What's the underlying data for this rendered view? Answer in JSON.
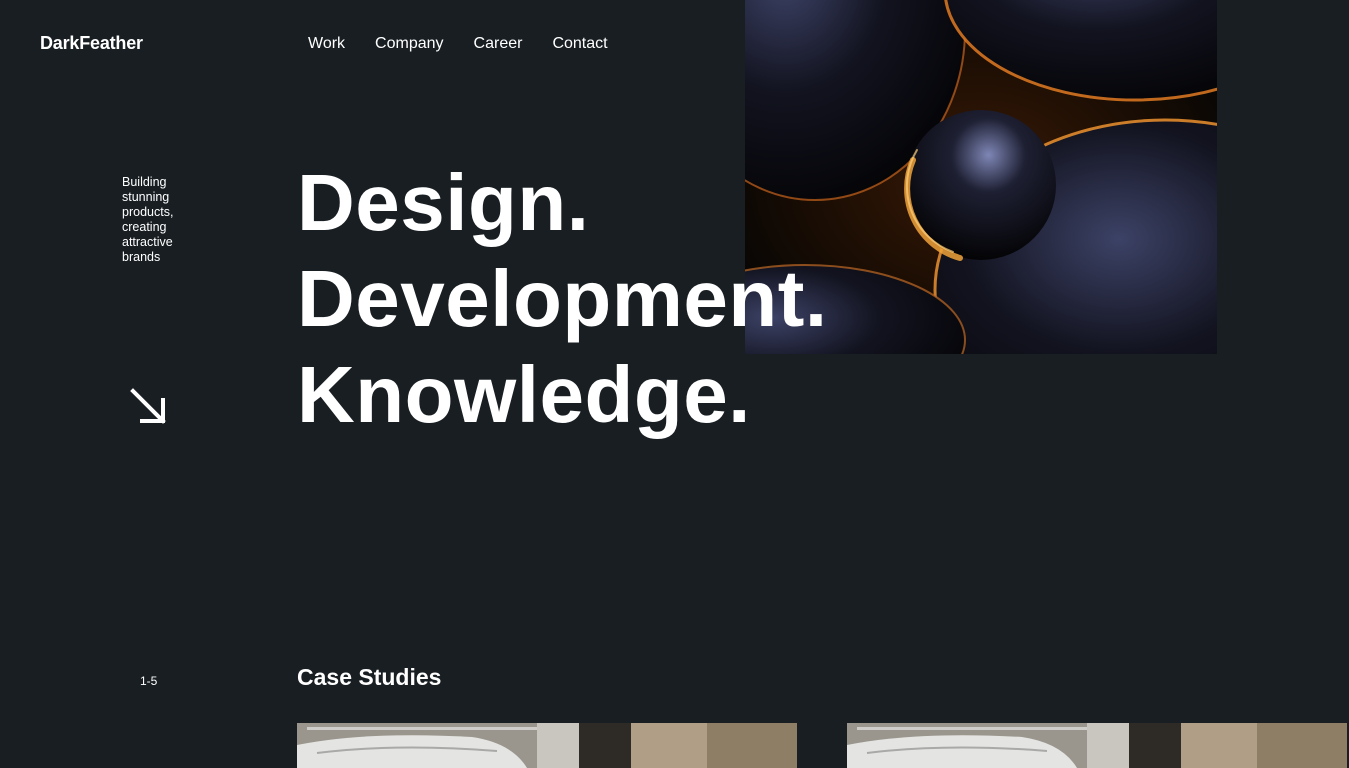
{
  "brand": {
    "name": "DarkFeather"
  },
  "nav": {
    "items": [
      {
        "label": "Work"
      },
      {
        "label": "Company"
      },
      {
        "label": "Career"
      },
      {
        "label": "Contact"
      }
    ]
  },
  "hero": {
    "tagline": "Building stunning products, creating attractive brands",
    "headline": [
      "Design.",
      "Development.",
      "Knowledge."
    ],
    "arrow_icon": "arrow-down-right-icon"
  },
  "case_studies": {
    "counter": "1-5",
    "title": "Case Studies",
    "cards": [
      {
        "image": "car-in-garage"
      },
      {
        "image": "car-in-garage"
      }
    ]
  },
  "colors": {
    "background": "#181e22",
    "text": "#ffffff",
    "accent": "#e08a2c"
  }
}
